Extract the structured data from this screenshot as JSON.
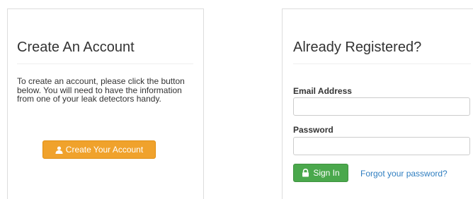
{
  "create_panel": {
    "title": "Create An Account",
    "intro": "To create an account, please click the button below. You will need to have the information from one of your leak detectors handy.",
    "button_label": "Create Your Account",
    "button_icon": "user-icon",
    "button_color": "#f0a22c"
  },
  "login_panel": {
    "title": "Already Registered?",
    "email_label": "Email Address",
    "email_value": "",
    "email_placeholder": "",
    "password_label": "Password",
    "password_value": "",
    "password_placeholder": "",
    "signin_label": "Sign In",
    "signin_icon": "lock-icon",
    "signin_color": "#4aa84c",
    "forgot_label": "Forgot your password?",
    "link_color": "#2f7ec0"
  }
}
